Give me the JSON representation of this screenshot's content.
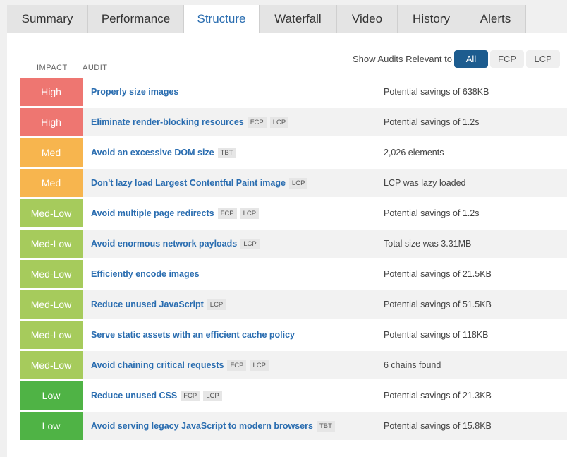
{
  "tabs": [
    {
      "label": "Summary",
      "active": false
    },
    {
      "label": "Performance",
      "active": false
    },
    {
      "label": "Structure",
      "active": true
    },
    {
      "label": "Waterfall",
      "active": false
    },
    {
      "label": "Video",
      "active": false
    },
    {
      "label": "History",
      "active": false
    },
    {
      "label": "Alerts",
      "active": false
    }
  ],
  "headers": {
    "impact": "IMPACT",
    "audit": "AUDIT"
  },
  "filter": {
    "label": "Show Audits Relevant to",
    "options": [
      "All",
      "FCP",
      "LCP"
    ],
    "selected": "All"
  },
  "impact_colors": {
    "High": "#ee7671",
    "Med": "#f7b54e",
    "Med-Low": "#a6cb5c",
    "Low": "#4fb345"
  },
  "tab_active_color": "#2a6db0",
  "filter_active_color": "#1d5c8f",
  "audits": [
    {
      "impact": "High",
      "name": "Properly size images",
      "tags": [],
      "result": "Potential savings of 638KB"
    },
    {
      "impact": "High",
      "name": "Eliminate render-blocking resources",
      "tags": [
        "FCP",
        "LCP"
      ],
      "result": "Potential savings of 1.2s"
    },
    {
      "impact": "Med",
      "name": "Avoid an excessive DOM size",
      "tags": [
        "TBT"
      ],
      "result": "2,026 elements"
    },
    {
      "impact": "Med",
      "name": "Don't lazy load Largest Contentful Paint image",
      "tags": [
        "LCP"
      ],
      "result": "LCP was lazy loaded"
    },
    {
      "impact": "Med-Low",
      "name": "Avoid multiple page redirects",
      "tags": [
        "FCP",
        "LCP"
      ],
      "result": "Potential savings of 1.2s"
    },
    {
      "impact": "Med-Low",
      "name": "Avoid enormous network payloads",
      "tags": [
        "LCP"
      ],
      "result": "Total size was 3.31MB"
    },
    {
      "impact": "Med-Low",
      "name": "Efficiently encode images",
      "tags": [],
      "result": "Potential savings of 21.5KB"
    },
    {
      "impact": "Med-Low",
      "name": "Reduce unused JavaScript",
      "tags": [
        "LCP"
      ],
      "result": "Potential savings of 51.5KB"
    },
    {
      "impact": "Med-Low",
      "name": "Serve static assets with an efficient cache policy",
      "tags": [],
      "result": "Potential savings of 118KB"
    },
    {
      "impact": "Med-Low",
      "name": "Avoid chaining critical requests",
      "tags": [
        "FCP",
        "LCP"
      ],
      "result": "6 chains found"
    },
    {
      "impact": "Low",
      "name": "Reduce unused CSS",
      "tags": [
        "FCP",
        "LCP"
      ],
      "result": "Potential savings of 21.3KB"
    },
    {
      "impact": "Low",
      "name": "Avoid serving legacy JavaScript to modern browsers",
      "tags": [
        "TBT"
      ],
      "result": "Potential savings of 15.8KB"
    }
  ]
}
